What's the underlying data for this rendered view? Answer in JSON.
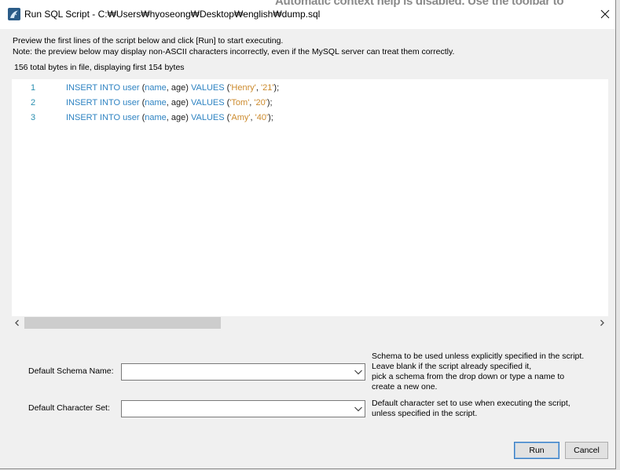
{
  "background_window": {
    "context_help_text": "Automatic context help is disabled. Use the toolbar to"
  },
  "window": {
    "title": "Run SQL Script - C:₩Users₩hyoseong₩Desktop₩english₩dump.sql",
    "app_icon": "mysql-workbench-icon",
    "close_icon": "close-icon"
  },
  "intro": {
    "instruction": "Preview the first lines of the script below and click [Run] to start executing.",
    "note": "Note: the preview below may display non-ASCII characters incorrectly, even if the MySQL server can treat them correctly.",
    "bytes_info": "156 total bytes in file, displaying first 154 bytes"
  },
  "editor": {
    "colors": {
      "keyword": "#2e83c2",
      "string": "#cc8a2c",
      "plain": "#202020",
      "line_number": "#2a8fb0"
    },
    "lines": [
      {
        "number": "1",
        "tokens": [
          {
            "text": "INSERT INTO user",
            "kind": "keyword"
          },
          {
            "text": " (",
            "kind": "plain"
          },
          {
            "text": "name",
            "kind": "keyword"
          },
          {
            "text": ", age) ",
            "kind": "plain"
          },
          {
            "text": "VALUES",
            "kind": "keyword"
          },
          {
            "text": " (",
            "kind": "plain"
          },
          {
            "text": "'Henry'",
            "kind": "string"
          },
          {
            "text": ", ",
            "kind": "plain"
          },
          {
            "text": "'21'",
            "kind": "string"
          },
          {
            "text": ");",
            "kind": "plain"
          }
        ]
      },
      {
        "number": "2",
        "tokens": [
          {
            "text": "INSERT INTO user",
            "kind": "keyword"
          },
          {
            "text": " (",
            "kind": "plain"
          },
          {
            "text": "name",
            "kind": "keyword"
          },
          {
            "text": ", age) ",
            "kind": "plain"
          },
          {
            "text": "VALUES",
            "kind": "keyword"
          },
          {
            "text": " (",
            "kind": "plain"
          },
          {
            "text": "'Tom'",
            "kind": "string"
          },
          {
            "text": ", ",
            "kind": "plain"
          },
          {
            "text": "'20'",
            "kind": "string"
          },
          {
            "text": ");",
            "kind": "plain"
          }
        ]
      },
      {
        "number": "3",
        "tokens": [
          {
            "text": "INSERT INTO user",
            "kind": "keyword"
          },
          {
            "text": " (",
            "kind": "plain"
          },
          {
            "text": "name",
            "kind": "keyword"
          },
          {
            "text": ", age) ",
            "kind": "plain"
          },
          {
            "text": "VALUES",
            "kind": "keyword"
          },
          {
            "text": " (",
            "kind": "plain"
          },
          {
            "text": "'Amy'",
            "kind": "string"
          },
          {
            "text": ", ",
            "kind": "plain"
          },
          {
            "text": "'40'",
            "kind": "string"
          },
          {
            "text": ");",
            "kind": "plain"
          }
        ]
      }
    ],
    "h_scrollbar": {
      "left_icon": "chevron-left-icon",
      "right_icon": "chevron-right-icon"
    }
  },
  "form": {
    "schema": {
      "label": "Default Schema Name:",
      "value": "",
      "dropdown_icon": "chevron-down-icon",
      "help": [
        "Schema to be used unless explicitly specified in the script.",
        "Leave blank if the script already specified it,",
        "pick a schema from the drop down or type a name to",
        "create a new one."
      ]
    },
    "charset": {
      "label": "Default Character Set:",
      "value": "",
      "dropdown_icon": "chevron-down-icon",
      "help": [
        "Default character set to use when executing the script,",
        "unless specified in the script."
      ]
    }
  },
  "buttons": {
    "run": "Run",
    "cancel": "Cancel"
  }
}
